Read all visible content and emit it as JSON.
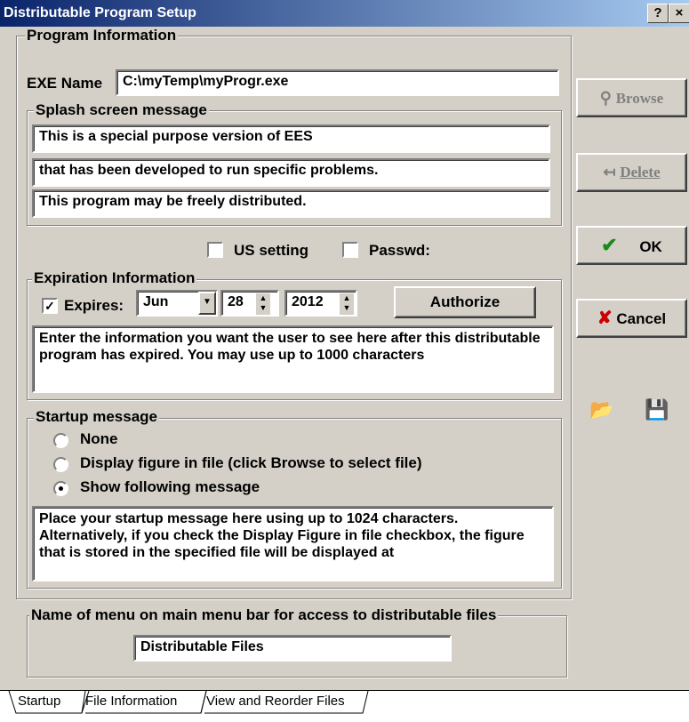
{
  "window": {
    "title": "Distributable Program Setup",
    "help_btn": "?",
    "close_btn": "×"
  },
  "program_info": {
    "group_label": "Program Information",
    "exe_label": "EXE Name",
    "exe_value": "C:\\myTemp\\myProgr.exe",
    "splash_label": "Splash screen message",
    "splash_lines": [
      "This is a special purpose version of EES",
      "that has been developed to run specific problems.",
      "This program may be freely distributed."
    ]
  },
  "options": {
    "us_setting": "US setting",
    "passwd": "Passwd:",
    "us_checked": false,
    "passwd_checked": false
  },
  "expiration": {
    "group_label": "Expiration Information",
    "expires_label": "Expires:",
    "expires_checked": true,
    "month": "Jun",
    "day": "28",
    "year": "2012",
    "authorize_label": "Authorize",
    "message": "Enter the information you want the user to see here after this distributable program has expired.  You may use up to 1000 characters"
  },
  "startup": {
    "group_label": "Startup message",
    "options": [
      "None",
      "Display figure in file  (click Browse to select file)",
      "Show following message"
    ],
    "selected": 2,
    "message": "Place your startup message here using up to 1024 characters. Alternatively, if you check the Display Figure in file checkbox, the figure that is stored in the specified file will be displayed at"
  },
  "menu_name": {
    "group_label": "Name of menu on main menu bar for access to  distributable files",
    "value": "Distributable Files"
  },
  "side_buttons": {
    "browse": "Browse",
    "delete": "Delete",
    "ok": "OK",
    "cancel": "Cancel"
  },
  "icons": {
    "browse": "binoculars-icon",
    "delete": "delete-icon",
    "ok": "checkmark-icon",
    "cancel": "x-icon",
    "open": "open-folder-icon",
    "save": "floppy-disk-icon"
  },
  "tabs": [
    "Startup",
    "File Information",
    "View and Reorder Files"
  ],
  "active_tab": 0
}
